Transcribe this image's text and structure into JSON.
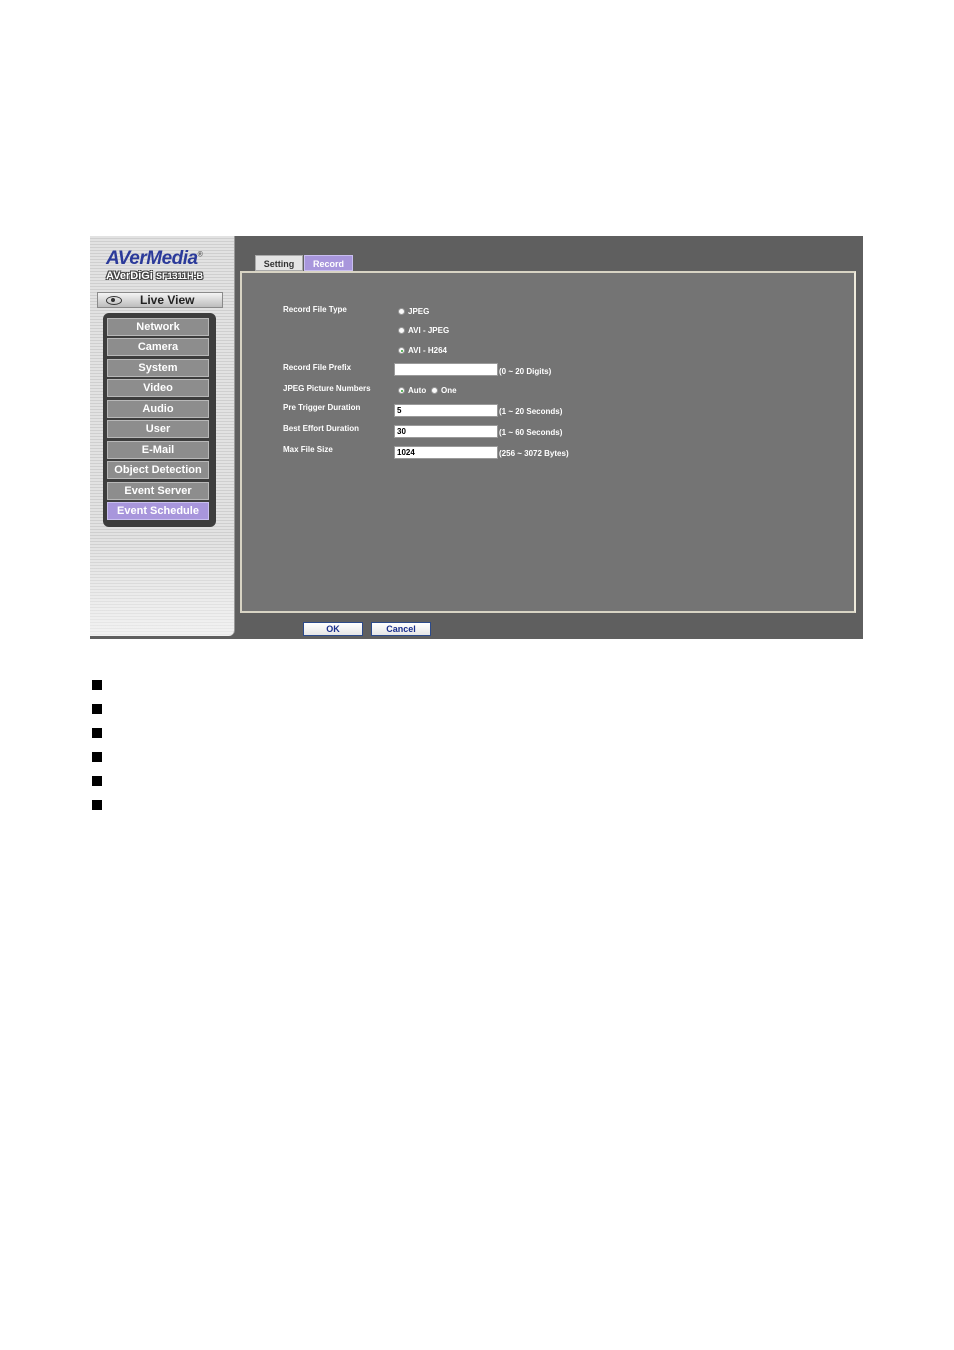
{
  "brand": {
    "logo": "AVerMedia",
    "logo_mark": "®",
    "model_name": "AVerDiGi",
    "model_code": "SF1311H-B"
  },
  "sidebar": {
    "live_view_label": "Live View",
    "items": [
      {
        "label": "Network",
        "active": false
      },
      {
        "label": "Camera",
        "active": false
      },
      {
        "label": "System",
        "active": false
      },
      {
        "label": "Video",
        "active": false
      },
      {
        "label": "Audio",
        "active": false
      },
      {
        "label": "User",
        "active": false
      },
      {
        "label": "E-Mail",
        "active": false
      },
      {
        "label": "Object Detection",
        "active": false
      },
      {
        "label": "Event Server",
        "active": false
      },
      {
        "label": "Event Schedule",
        "active": true
      }
    ]
  },
  "tabs": [
    {
      "label": "Setting",
      "active": false
    },
    {
      "label": "Record",
      "active": true
    }
  ],
  "form": {
    "record_file_type": {
      "label": "Record File Type",
      "options": [
        "JPEG",
        "AVI - JPEG",
        "AVI - H264"
      ],
      "selected": "AVI - H264"
    },
    "record_file_prefix": {
      "label": "Record File Prefix",
      "value": "",
      "hint": "(0 ~ 20 Digits)"
    },
    "jpeg_picture_numbers": {
      "label": "JPEG Picture Numbers",
      "options": [
        "Auto",
        "One"
      ],
      "selected": "Auto"
    },
    "pre_trigger_duration": {
      "label": "Pre Trigger Duration",
      "value": "5",
      "hint": "(1 ~ 20 Seconds)"
    },
    "best_effort_duration": {
      "label": "Best Effort Duration",
      "value": "30",
      "hint": "(1 ~ 60 Seconds)"
    },
    "max_file_size": {
      "label": "Max File Size",
      "value": "1024",
      "hint": "(256 ~ 3072 Bytes)"
    }
  },
  "buttons": {
    "ok": "OK",
    "cancel": "Cancel"
  },
  "colors": {
    "accent": "#a896dc",
    "panel": "#747474",
    "frame": "#5f5f5f"
  },
  "bullet_count": 6
}
